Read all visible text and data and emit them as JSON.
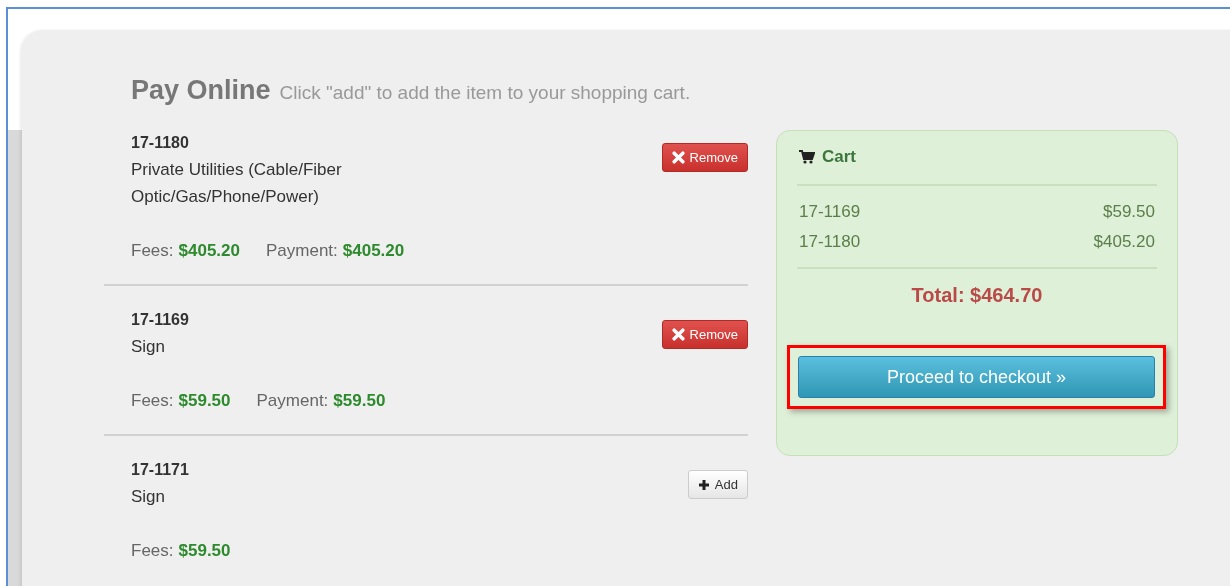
{
  "header": {
    "title": "Pay Online",
    "subtitle": "Click \"add\" to add the item to your shopping cart."
  },
  "items": [
    {
      "id": "17-1180",
      "description": "Private Utilities (Cable/Fiber Optic/Gas/Phone/Power)",
      "fees_label": "Fees:",
      "fees": "$405.20",
      "payment_label": "Payment:",
      "payment": "$405.20",
      "in_cart": true,
      "button": "Remove"
    },
    {
      "id": "17-1169",
      "description": "Sign",
      "fees_label": "Fees:",
      "fees": "$59.50",
      "payment_label": "Payment:",
      "payment": "$59.50",
      "in_cart": true,
      "button": "Remove"
    },
    {
      "id": "17-1171",
      "description": "Sign",
      "fees_label": "Fees:",
      "fees": "$59.50",
      "in_cart": false,
      "button": "Add"
    }
  ],
  "cart": {
    "title": "Cart",
    "rows": [
      {
        "id": "17-1169",
        "amount": "$59.50"
      },
      {
        "id": "17-1180",
        "amount": "$405.20"
      }
    ],
    "total": "Total: $464.70",
    "checkout": {
      "label": "Proceed to checkout »",
      "highlighted": true
    }
  }
}
